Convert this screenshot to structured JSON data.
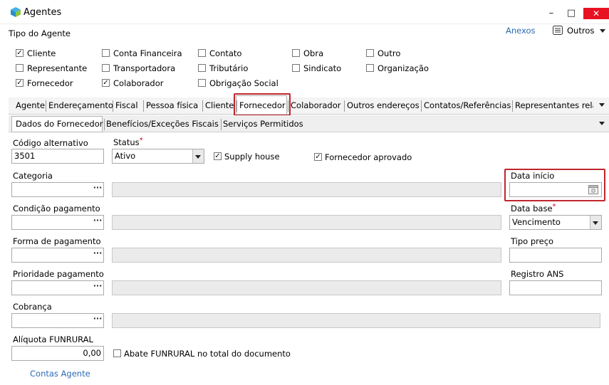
{
  "window": {
    "title": "Agentes",
    "minimize_glyph": "–",
    "maximize_glyph": "□",
    "close_glyph": "✕"
  },
  "header": {
    "section_label": "Tipo do Agente",
    "anexos_label": "Anexos",
    "outros_label": "Outros"
  },
  "agent_types": [
    {
      "label": "Cliente",
      "checked": true
    },
    {
      "label": "Conta Financeira",
      "checked": false
    },
    {
      "label": "Contato",
      "checked": false
    },
    {
      "label": "Obra",
      "checked": false
    },
    {
      "label": "Outro",
      "checked": false
    },
    {
      "label": "Representante",
      "checked": false
    },
    {
      "label": "Transportadora",
      "checked": false
    },
    {
      "label": "Tributário",
      "checked": false
    },
    {
      "label": "Sindicato",
      "checked": false
    },
    {
      "label": "Organização",
      "checked": false
    },
    {
      "label": "Fornecedor",
      "checked": true
    },
    {
      "label": "Colaborador",
      "checked": true
    },
    {
      "label": "Obrigação Social",
      "checked": false
    }
  ],
  "tabs": [
    "Agente",
    "Endereçamento",
    "Fiscal",
    "Pessoa física",
    "Cliente",
    "Fornecedor",
    "Colaborador",
    "Outros endereços",
    "Contatos/Referências",
    "Representantes relac"
  ],
  "active_tab": "Fornecedor",
  "subtabs": [
    "Dados do Fornecedor",
    "Benefícios/Exceções Fiscais",
    "Serviços Permitidos"
  ],
  "active_subtab": "Dados do Fornecedor",
  "form": {
    "codigo_alternativo": {
      "label": "Código alternativo",
      "value": "3501"
    },
    "status": {
      "label": "Status",
      "required_mark": "*",
      "value": "Ativo"
    },
    "supply_house": {
      "label": "Supply house",
      "checked": true
    },
    "fornecedor_aprovado": {
      "label": "Fornecedor aprovado",
      "checked": true
    },
    "categoria": {
      "label": "Categoria",
      "value": ""
    },
    "data_inicio": {
      "label": "Data início",
      "value": ""
    },
    "condicao_pagamento": {
      "label": "Condição pagamento",
      "value": ""
    },
    "data_base": {
      "label": "Data base",
      "required_mark": "*",
      "value": "Vencimento"
    },
    "forma_pagamento": {
      "label": "Forma de pagamento",
      "value": ""
    },
    "tipo_preco": {
      "label": "Tipo preço",
      "value": ""
    },
    "prioridade_pagamento": {
      "label": "Prioridade pagamento",
      "value": ""
    },
    "registro_ans": {
      "label": "Registro ANS",
      "value": ""
    },
    "cobranca": {
      "label": "Cobrança",
      "value": ""
    },
    "aliquota_funrural": {
      "label": "Alíquota FUNRURAL",
      "value": "0,00"
    },
    "abate_funrural": {
      "label": "Abate FUNRURAL no total do documento",
      "checked": false
    },
    "contas_agente_link": "Contas Agente",
    "ellipsis": "···"
  },
  "colors": {
    "highlight_border": "#c0262d",
    "link": "#2b6bb3",
    "required": "#d0021b",
    "close_button": "#e81123"
  },
  "icons": [
    "app-cube-icon",
    "minimize-icon",
    "maximize-icon",
    "close-icon",
    "outros-menu-icon",
    "chevron-down-icon",
    "calendar-icon"
  ]
}
